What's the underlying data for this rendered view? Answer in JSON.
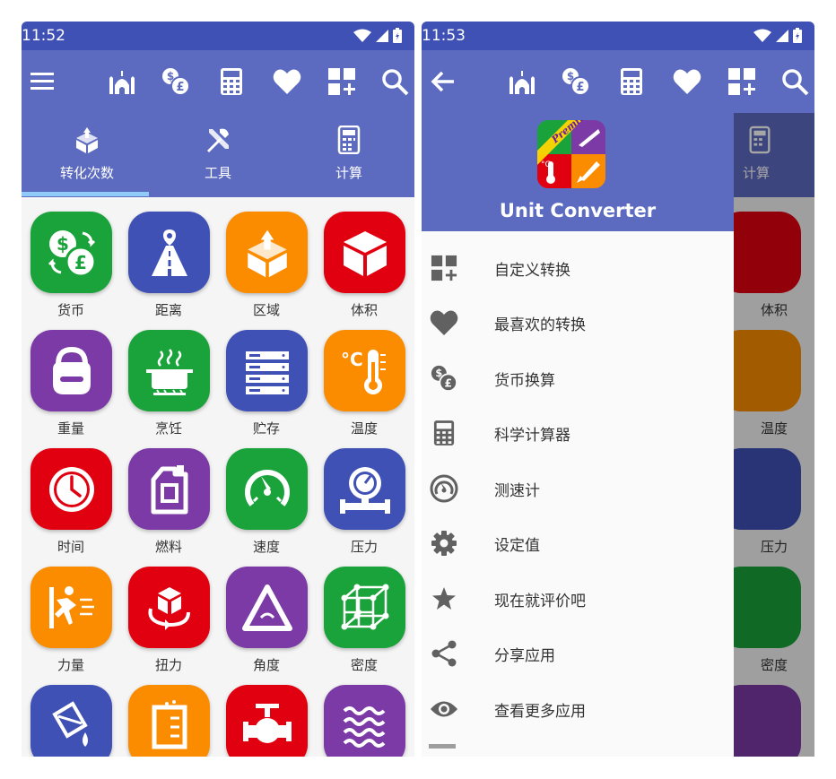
{
  "status": {
    "time_left": "11:52",
    "time_right": "11:53"
  },
  "toolbar": {
    "icons": [
      "menu-icon",
      "mosque-icon",
      "currency-exchange-icon",
      "calculator-icon",
      "heart-icon",
      "custom-grid-icon",
      "search-icon"
    ]
  },
  "tabs": [
    {
      "label": "转化次数",
      "icon": "convert-cube-icon"
    },
    {
      "label": "工具",
      "icon": "tools-icon"
    },
    {
      "label": "计算",
      "icon": "calculator-icon"
    }
  ],
  "grid": [
    {
      "label": "货币",
      "icon": "currency-icon",
      "color": "#1aa33a"
    },
    {
      "label": "距离",
      "icon": "road-icon",
      "color": "#3f51b5"
    },
    {
      "label": "区域",
      "icon": "area-icon",
      "color": "#fb8c00"
    },
    {
      "label": "体积",
      "icon": "cube-icon",
      "color": "#e00010"
    },
    {
      "label": "重量",
      "icon": "weight-icon",
      "color": "#7b3aa5"
    },
    {
      "label": "烹饪",
      "icon": "cooking-pot-icon",
      "color": "#1aa33a"
    },
    {
      "label": "贮存",
      "icon": "storage-icon",
      "color": "#3f51b5"
    },
    {
      "label": "温度",
      "icon": "thermometer-icon",
      "color": "#fb8c00"
    },
    {
      "label": "时间",
      "icon": "clock-icon",
      "color": "#e00010"
    },
    {
      "label": "燃料",
      "icon": "fuel-can-icon",
      "color": "#7b3aa5"
    },
    {
      "label": "速度",
      "icon": "speedometer-icon",
      "color": "#1aa33a"
    },
    {
      "label": "压力",
      "icon": "pressure-gauge-icon",
      "color": "#3f51b5"
    },
    {
      "label": "力量",
      "icon": "force-icon",
      "color": "#fb8c00"
    },
    {
      "label": "扭力",
      "icon": "torque-icon",
      "color": "#e00010"
    },
    {
      "label": "角度",
      "icon": "angle-icon",
      "color": "#7b3aa5"
    },
    {
      "label": "密度",
      "icon": "density-icon",
      "color": "#1aa33a"
    },
    {
      "label": "",
      "icon": "bucket-icon",
      "color": "#3f51b5"
    },
    {
      "label": "",
      "icon": "beaker-icon",
      "color": "#fb8c00"
    },
    {
      "label": "",
      "icon": "valve-icon",
      "color": "#e00010"
    },
    {
      "label": "",
      "icon": "waves-icon",
      "color": "#7b3aa5"
    }
  ],
  "drawer": {
    "title": "Unit Converter",
    "logo_text": "Premium",
    "items": [
      {
        "label": "自定义转换",
        "icon": "custom-grid-icon"
      },
      {
        "label": "最喜欢的转换",
        "icon": "heart-icon"
      },
      {
        "label": "货币换算",
        "icon": "currency-exchange-icon"
      },
      {
        "label": "科学计算器",
        "icon": "calculator-icon"
      },
      {
        "label": "测速计",
        "icon": "speedometer-icon"
      },
      {
        "label": "设定值",
        "icon": "gear-icon"
      },
      {
        "label": "现在就评价吧",
        "icon": "star-icon"
      },
      {
        "label": "分享应用",
        "icon": "share-icon"
      },
      {
        "label": "查看更多应用",
        "icon": "eye-icon"
      }
    ]
  },
  "behind": {
    "tab_label": "计算",
    "labels": [
      "体积",
      "温度",
      "压力",
      "密度"
    ]
  }
}
